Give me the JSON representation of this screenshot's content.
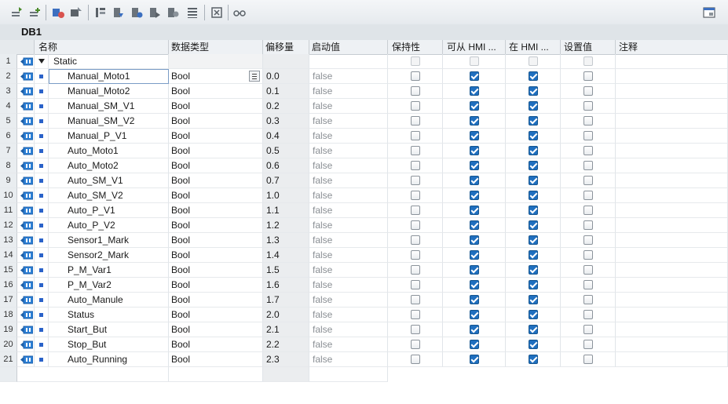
{
  "toolbar": {
    "icons": [
      "insert-row-icon",
      "add-row-icon",
      "snapshot-icon",
      "copy-snapshot-icon",
      "monitor-icon",
      "load-start-icon",
      "load-snapshot-icon",
      "set-start-icon",
      "set-snapshot-icon",
      "list-icon",
      "expand-icon",
      "glasses-icon",
      "panel-icon"
    ]
  },
  "db": {
    "title": "DB1"
  },
  "columns": {
    "name": "名称",
    "datatype": "数据类型",
    "offset": "偏移量",
    "start": "启动值",
    "retain": "保持性",
    "hmi_access": "可从 HMI ...",
    "hmi_visible": "在 HMI ...",
    "setpoint": "设置值",
    "comment": "注释"
  },
  "static_row": {
    "index": "1",
    "name": "Static"
  },
  "rows": [
    {
      "index": "2",
      "name": "Manual_Moto1",
      "type": "Bool",
      "offset": "0.0",
      "start": "false"
    },
    {
      "index": "3",
      "name": "Manual_Moto2",
      "type": "Bool",
      "offset": "0.1",
      "start": "false"
    },
    {
      "index": "4",
      "name": "Manual_SM_V1",
      "type": "Bool",
      "offset": "0.2",
      "start": "false"
    },
    {
      "index": "5",
      "name": "Manual_SM_V2",
      "type": "Bool",
      "offset": "0.3",
      "start": "false"
    },
    {
      "index": "6",
      "name": "Manual_P_V1",
      "type": "Bool",
      "offset": "0.4",
      "start": "false"
    },
    {
      "index": "7",
      "name": "Auto_Moto1",
      "type": "Bool",
      "offset": "0.5",
      "start": "false"
    },
    {
      "index": "8",
      "name": "Auto_Moto2",
      "type": "Bool",
      "offset": "0.6",
      "start": "false"
    },
    {
      "index": "9",
      "name": "Auto_SM_V1",
      "type": "Bool",
      "offset": "0.7",
      "start": "false"
    },
    {
      "index": "10",
      "name": "Auto_SM_V2",
      "type": "Bool",
      "offset": "1.0",
      "start": "false"
    },
    {
      "index": "11",
      "name": "Auto_P_V1",
      "type": "Bool",
      "offset": "1.1",
      "start": "false"
    },
    {
      "index": "12",
      "name": "Auto_P_V2",
      "type": "Bool",
      "offset": "1.2",
      "start": "false"
    },
    {
      "index": "13",
      "name": "Sensor1_Mark",
      "type": "Bool",
      "offset": "1.3",
      "start": "false"
    },
    {
      "index": "14",
      "name": "Sensor2_Mark",
      "type": "Bool",
      "offset": "1.4",
      "start": "false"
    },
    {
      "index": "15",
      "name": "P_M_Var1",
      "type": "Bool",
      "offset": "1.5",
      "start": "false"
    },
    {
      "index": "16",
      "name": "P_M_Var2",
      "type": "Bool",
      "offset": "1.6",
      "start": "false"
    },
    {
      "index": "17",
      "name": "Auto_Manule",
      "type": "Bool",
      "offset": "1.7",
      "start": "false"
    },
    {
      "index": "18",
      "name": "Status",
      "type": "Bool",
      "offset": "2.0",
      "start": "false"
    },
    {
      "index": "19",
      "name": "Start_But",
      "type": "Bool",
      "offset": "2.1",
      "start": "false"
    },
    {
      "index": "20",
      "name": "Stop_But",
      "type": "Bool",
      "offset": "2.2",
      "start": "false"
    },
    {
      "index": "21",
      "name": "Auto_Running",
      "type": "Bool",
      "offset": "2.3",
      "start": "false"
    }
  ],
  "checkbox_defaults": {
    "retain": false,
    "hmi_access": true,
    "hmi_visible": true,
    "setpoint": false
  },
  "colors": {
    "accent": "#1f6fbf",
    "header_bg": "#dfe4e8",
    "offset_bg": "#ebedef"
  }
}
